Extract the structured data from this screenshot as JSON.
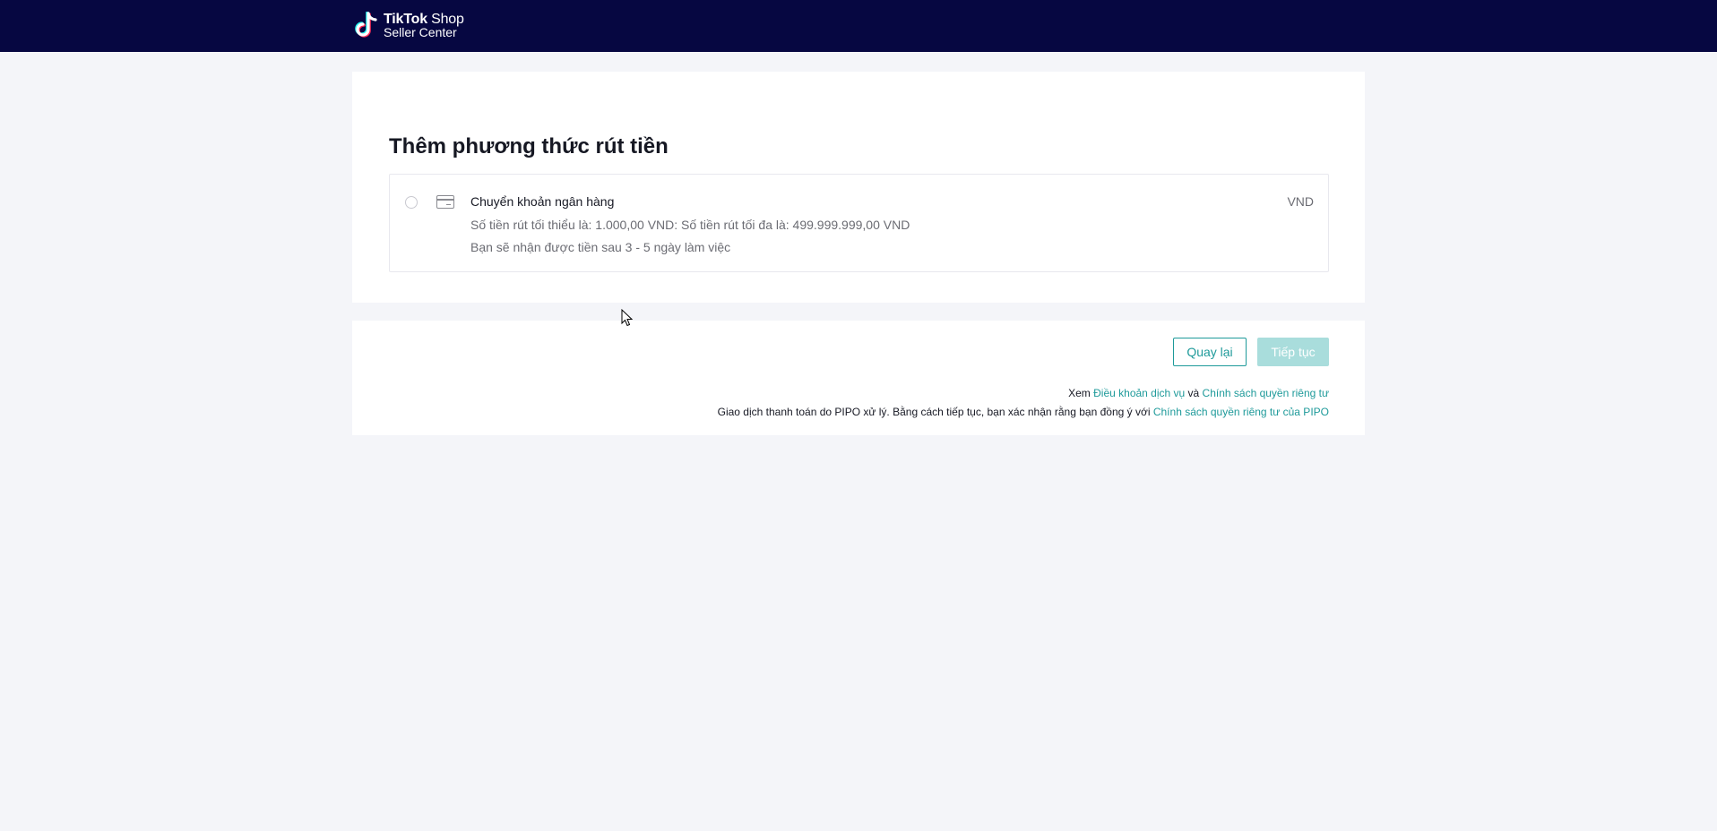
{
  "header": {
    "brand_main": "TikTok",
    "brand_shop": " Shop",
    "brand_sub": "Seller Center",
    "background_color": "#060741"
  },
  "page": {
    "title": "Thêm phương thức rút tiền"
  },
  "payment_method": {
    "icon": "credit-card-icon",
    "name": "Chuyển khoản ngân hàng",
    "limits": "Số tiền rút tối thiểu là: 1.000,00 VND: Số tiền rút tối đa là: 499.999.999,00 VND",
    "processing_time": "Bạn sẽ nhận được tiền sau 3 - 5 ngày làm việc",
    "currency": "VND",
    "selected": false
  },
  "actions": {
    "back_label": "Quay lại",
    "next_label": "Tiếp tục",
    "next_enabled": false
  },
  "terms": {
    "line1_prefix": "Xem ",
    "terms_link": "Điều khoản dịch vụ",
    "line1_and": " và ",
    "privacy_link": "Chính sách quyền riêng tư",
    "line2_prefix": "Giao dịch thanh toán do PIPO xử lý. Bằng cách tiếp tục, bạn xác nhận rằng bạn đồng ý với ",
    "pipo_privacy_link": "Chính sách quyền riêng tư của PIPO"
  },
  "colors": {
    "accent": "#1e9a9a",
    "accent_disabled": "#a9dddc"
  }
}
